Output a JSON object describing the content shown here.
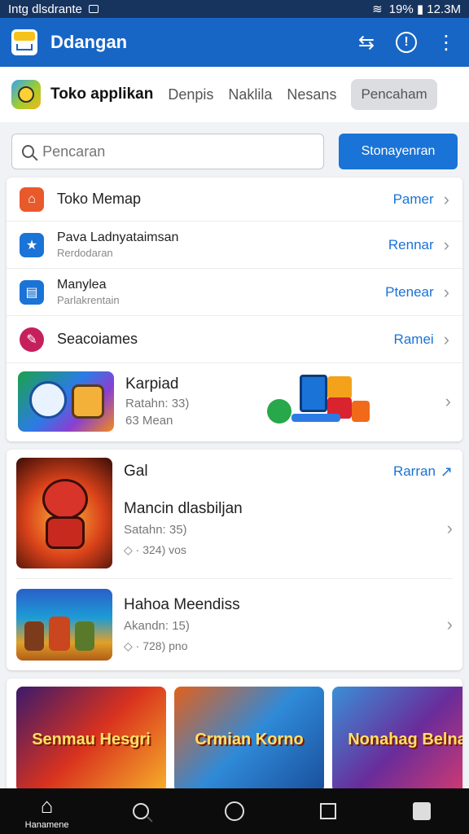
{
  "status": {
    "left_text": "Intg dlsdrante",
    "right_text": "19% ▮ 12.3M"
  },
  "appbar": {
    "title": "Ddangan",
    "icons": [
      "share-icon",
      "info-icon",
      "more-vert-icon"
    ]
  },
  "tabs": {
    "items": [
      {
        "label": "Toko applikan"
      },
      {
        "label": "Denpis"
      },
      {
        "label": "Naklila"
      },
      {
        "label": "Nesans"
      },
      {
        "label": "Pencaham"
      }
    ]
  },
  "search": {
    "placeholder": "Pencaran",
    "button_label": "Stonayenran"
  },
  "menu": {
    "items": [
      {
        "title": "Toko Memap",
        "subtitle": "",
        "action": "Pamer",
        "color": "#e8592b"
      },
      {
        "title": "Pava Ladnyataimsan",
        "subtitle": "Rerdodaran",
        "action": "Rennar",
        "color": "#1a73d6"
      },
      {
        "title": "Manylea",
        "subtitle": "Parlakrentain",
        "action": "Ptenear",
        "color": "#1a73d6"
      },
      {
        "title": "Seacoiames",
        "subtitle": "",
        "action": "Ramei",
        "color": "#c6205c"
      }
    ],
    "featured": {
      "title": "Karpiad",
      "subtitle": "Ratahn: 33)",
      "meta": "63 Mean"
    }
  },
  "games": {
    "header": "Gal",
    "header_action": "Rarran",
    "items": [
      {
        "title": "Mancin dlasbiljan",
        "subtitle": "Satahn: 35)",
        "stat": "· 324) vos"
      },
      {
        "title": "Hahoa Meendiss",
        "subtitle": "Akandn: 15)",
        "stat": "· 728) pno"
      }
    ]
  },
  "strip": [
    {
      "label": "Senmau Hesgri"
    },
    {
      "label": "Crmian Korno"
    },
    {
      "label": "Nonahag Belna"
    }
  ],
  "navbar": {
    "home_label": "Hanamene"
  }
}
